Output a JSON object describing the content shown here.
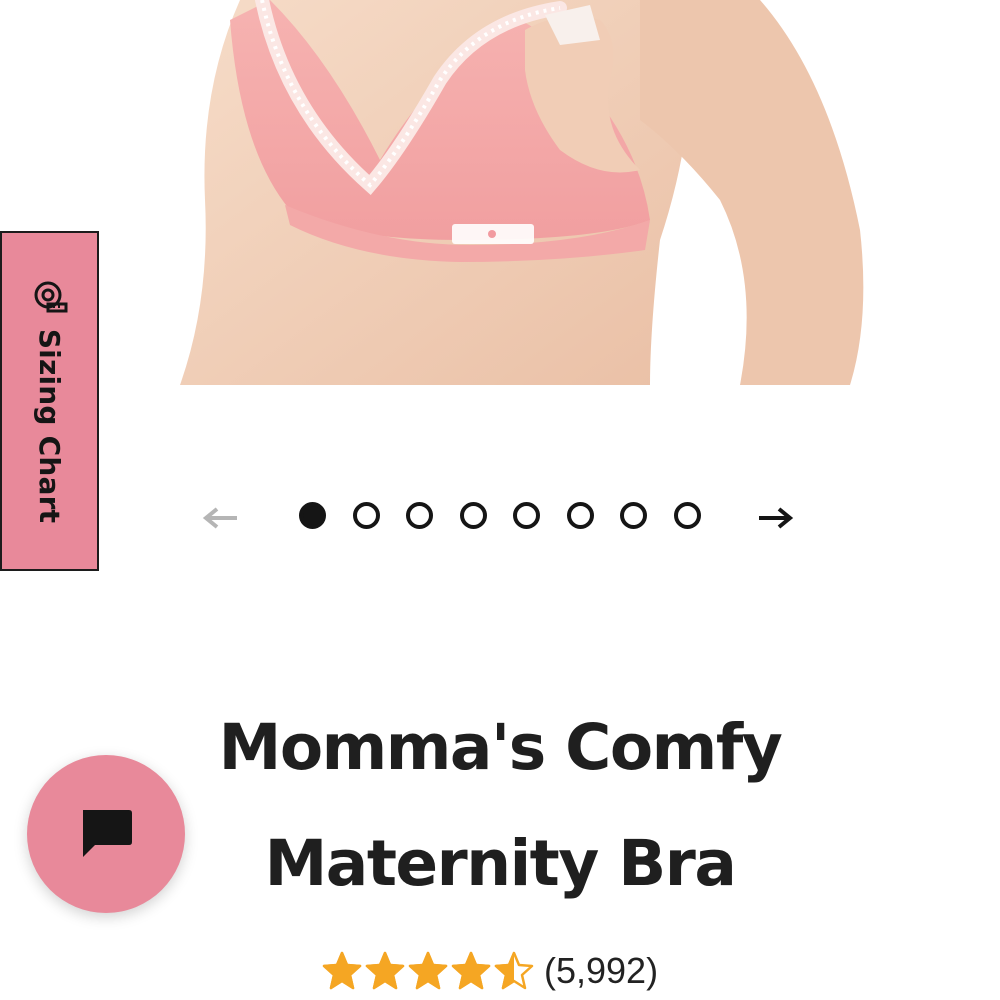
{
  "product": {
    "title_line1": "Momma's Comfy",
    "title_line2": "Maternity Bra",
    "rating": 4.5,
    "rating_max": 5,
    "review_count": "(5,992)"
  },
  "sizing_tab": {
    "label": "Sizing Chart",
    "icon": "measuring-tape-icon"
  },
  "carousel": {
    "slide_count": 8,
    "active_index": 0,
    "prev_icon": "arrow-left-icon",
    "next_icon": "arrow-right-icon"
  },
  "chat": {
    "icon": "chat-bubble-icon"
  },
  "colors": {
    "accent_pink": "#e8899a",
    "text_dark": "#1f1f1f",
    "star_orange": "#f5a623",
    "arrow_disabled": "#b5b5b5"
  }
}
